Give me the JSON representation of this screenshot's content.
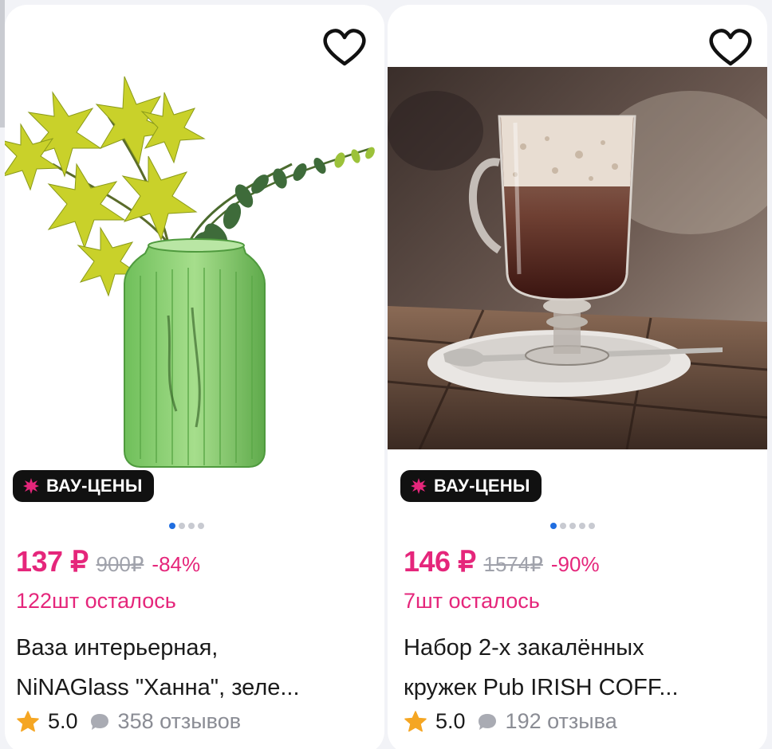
{
  "products": [
    {
      "badge": "ВАУ-ЦЕНЫ",
      "price": "137 ₽",
      "old_price": "900₽",
      "discount": "-84%",
      "stock": "122шт осталось",
      "title_line1": "Ваза интерьерная,",
      "title_line2": "NiNAGlass \"Ханна\", зеле...",
      "rating": "5.0",
      "reviews": "358 отзывов",
      "image_icon": "green-glass-vase-with-plants",
      "carousel_dots": 4,
      "carousel_active": 0
    },
    {
      "badge": "ВАУ-ЦЕНЫ",
      "price": "146 ₽",
      "old_price": "1574₽",
      "discount": "-90%",
      "stock": "7шт осталось",
      "title_line1": "Набор 2-х закалённых",
      "title_line2": "кружек Pub IRISH COFF...",
      "rating": "5.0",
      "reviews": "192 отзыва",
      "image_icon": "irish-coffee-glass-on-saucer",
      "carousel_dots": 5,
      "carousel_active": 0
    }
  ],
  "colors": {
    "accent": "#e5267b",
    "badge_bg": "#111111",
    "dot_active": "#1f6de0",
    "star": "#f5a623"
  }
}
